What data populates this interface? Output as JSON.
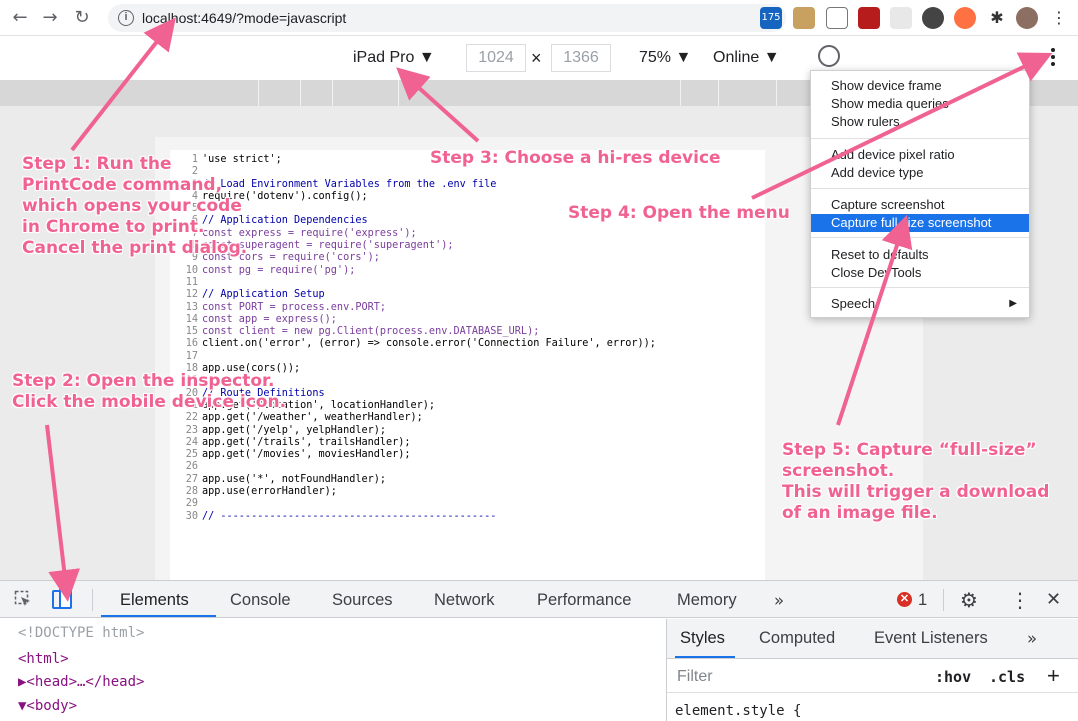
{
  "browser": {
    "url": "localhost:4649/?mode=javascript",
    "extension_badge": "175"
  },
  "device_toolbar": {
    "device": "iPad Pro ▼",
    "width": "1024",
    "times": "×",
    "height": "1366",
    "zoom": "75% ▼",
    "network": "Online ▼"
  },
  "code_lines": [
    {
      "n": "1",
      "t": "'use strict';"
    },
    {
      "n": "2",
      "t": ""
    },
    {
      "n": "3",
      "t": "// Load Environment Variables from the .env file"
    },
    {
      "n": "4",
      "t": "require('dotenv').config();"
    },
    {
      "n": "5",
      "t": ""
    },
    {
      "n": "6",
      "t": "// Application Dependencies"
    },
    {
      "n": "7",
      "t": "const express = require('express');"
    },
    {
      "n": "8",
      "t": "const superagent = require('superagent');"
    },
    {
      "n": "9",
      "t": "const cors = require('cors');"
    },
    {
      "n": "10",
      "t": "const pg = require('pg');"
    },
    {
      "n": "11",
      "t": ""
    },
    {
      "n": "12",
      "t": "// Application Setup"
    },
    {
      "n": "13",
      "t": "const PORT = process.env.PORT;"
    },
    {
      "n": "14",
      "t": "const app = express();"
    },
    {
      "n": "15",
      "t": "const client = new pg.Client(process.env.DATABASE_URL);"
    },
    {
      "n": "16",
      "t": "client.on('error', (error) => console.error('Connection Failure', error));"
    },
    {
      "n": "17",
      "t": ""
    },
    {
      "n": "18",
      "t": "app.use(cors());"
    },
    {
      "n": "19",
      "t": ""
    },
    {
      "n": "20",
      "t": "// Route Definitions"
    },
    {
      "n": "21",
      "t": "app.get('/location', locationHandler);"
    },
    {
      "n": "22",
      "t": "app.get('/weather', weatherHandler);"
    },
    {
      "n": "23",
      "t": "app.get('/yelp', yelpHandler);"
    },
    {
      "n": "24",
      "t": "app.get('/trails', trailsHandler);"
    },
    {
      "n": "25",
      "t": "app.get('/movies', moviesHandler);"
    },
    {
      "n": "26",
      "t": ""
    },
    {
      "n": "27",
      "t": "app.use('*', notFoundHandler);"
    },
    {
      "n": "28",
      "t": "app.use(errorHandler);"
    },
    {
      "n": "29",
      "t": ""
    },
    {
      "n": "30",
      "t": "// ---------------------------------------------"
    }
  ],
  "menu": {
    "items": [
      {
        "label": "Show device frame"
      },
      {
        "label": "Show media queries"
      },
      {
        "label": "Show rulers"
      },
      {
        "label": "Add device pixel ratio"
      },
      {
        "label": "Add device type"
      },
      {
        "label": "Capture screenshot"
      },
      {
        "label": "Capture full size screenshot"
      },
      {
        "label": "Reset to defaults"
      },
      {
        "label": "Close DevTools"
      },
      {
        "label": "Speech"
      }
    ],
    "submenu_arrow": "▶"
  },
  "devtools": {
    "tabs": [
      "Elements",
      "Console",
      "Sources",
      "Network",
      "Performance",
      "Memory"
    ],
    "more": "»",
    "error_count": "1",
    "close": "✕",
    "dom": [
      "<!DOCTYPE html>",
      "<html>",
      "▶<head>…</head>",
      "▼<body>"
    ],
    "styles_tabs": [
      "Styles",
      "Computed",
      "Event Listeners"
    ],
    "styles_more": "»",
    "filter_placeholder": "Filter",
    "hov": ":hov",
    "cls": ".cls",
    "plus": "+",
    "element_style": "element.style {"
  },
  "annotations": {
    "step1": [
      "Step 1: Run the",
      "PrintCode command,",
      "which opens your code",
      "in Chrome to print.",
      "Cancel the print dialog."
    ],
    "step2": [
      "Step 2: Open the inspector.",
      "Click the mobile device icon."
    ],
    "step3": "Step 3: Choose a hi-res device",
    "step4": "Step 4: Open the menu",
    "step5": [
      "Step 5: Capture “full-size”",
      "screenshot.",
      "This will trigger a download",
      "of an image file."
    ]
  },
  "colors": {
    "annotation": "#f06292",
    "menu_highlight": "#1a73e8",
    "error_icon": "#d93025"
  }
}
